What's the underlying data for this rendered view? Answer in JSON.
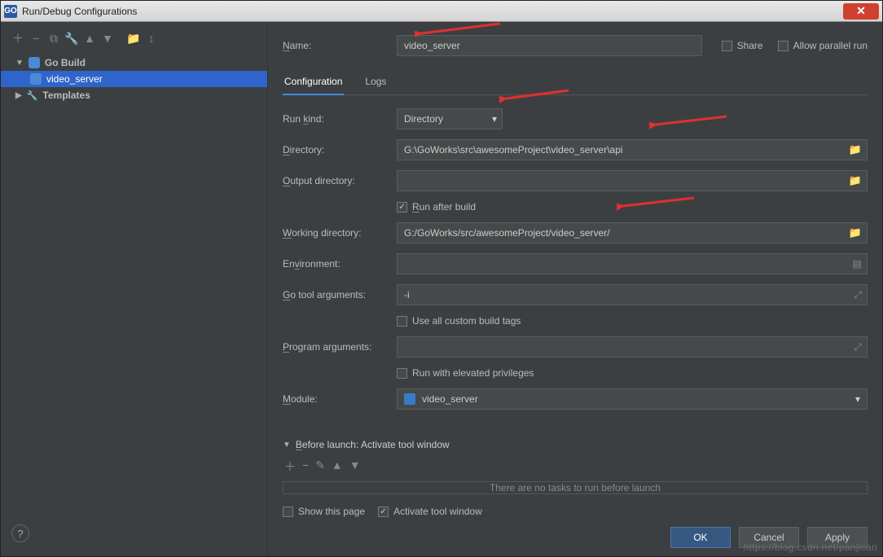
{
  "window": {
    "title": "Run/Debug Configurations",
    "icon_text": "GO",
    "close_glyph": "✕"
  },
  "header_checks": {
    "share": "Share",
    "allow_parallel": "Allow parallel run"
  },
  "tree": {
    "go_build": "Go Build",
    "video_server": "video_server",
    "templates": "Templates"
  },
  "name_label": "Name:",
  "name_value": "video_server",
  "tabs": {
    "configuration": "Configuration",
    "logs": "Logs"
  },
  "fields": {
    "run_kind_label": "Run kind:",
    "run_kind_value": "Directory",
    "directory_label": "Directory:",
    "directory_value": "G:\\GoWorks\\src\\awesomeProject\\video_server\\api",
    "output_dir_label": "Output directory:",
    "output_dir_value": "",
    "run_after_build": "Run after build",
    "working_dir_label": "Working directory:",
    "working_dir_value": "G:/GoWorks/src/awesomeProject/video_server/",
    "environment_label": "Environment:",
    "environment_value": "",
    "go_tool_args_label": "Go tool arguments:",
    "go_tool_args_value": "-i",
    "use_custom_tags": "Use all custom build tags",
    "program_args_label": "Program arguments:",
    "program_args_value": "",
    "elevated": "Run with elevated privileges",
    "module_label": "Module:",
    "module_value": "video_server"
  },
  "before_launch": {
    "header": "Before launch: Activate tool window",
    "empty": "There are no tasks to run before launch",
    "show_this_page": "Show this page",
    "activate_tool_window": "Activate tool window"
  },
  "buttons": {
    "ok": "OK",
    "cancel": "Cancel",
    "apply": "Apply"
  },
  "watermark": "https://blog.csdn.net/panjican"
}
